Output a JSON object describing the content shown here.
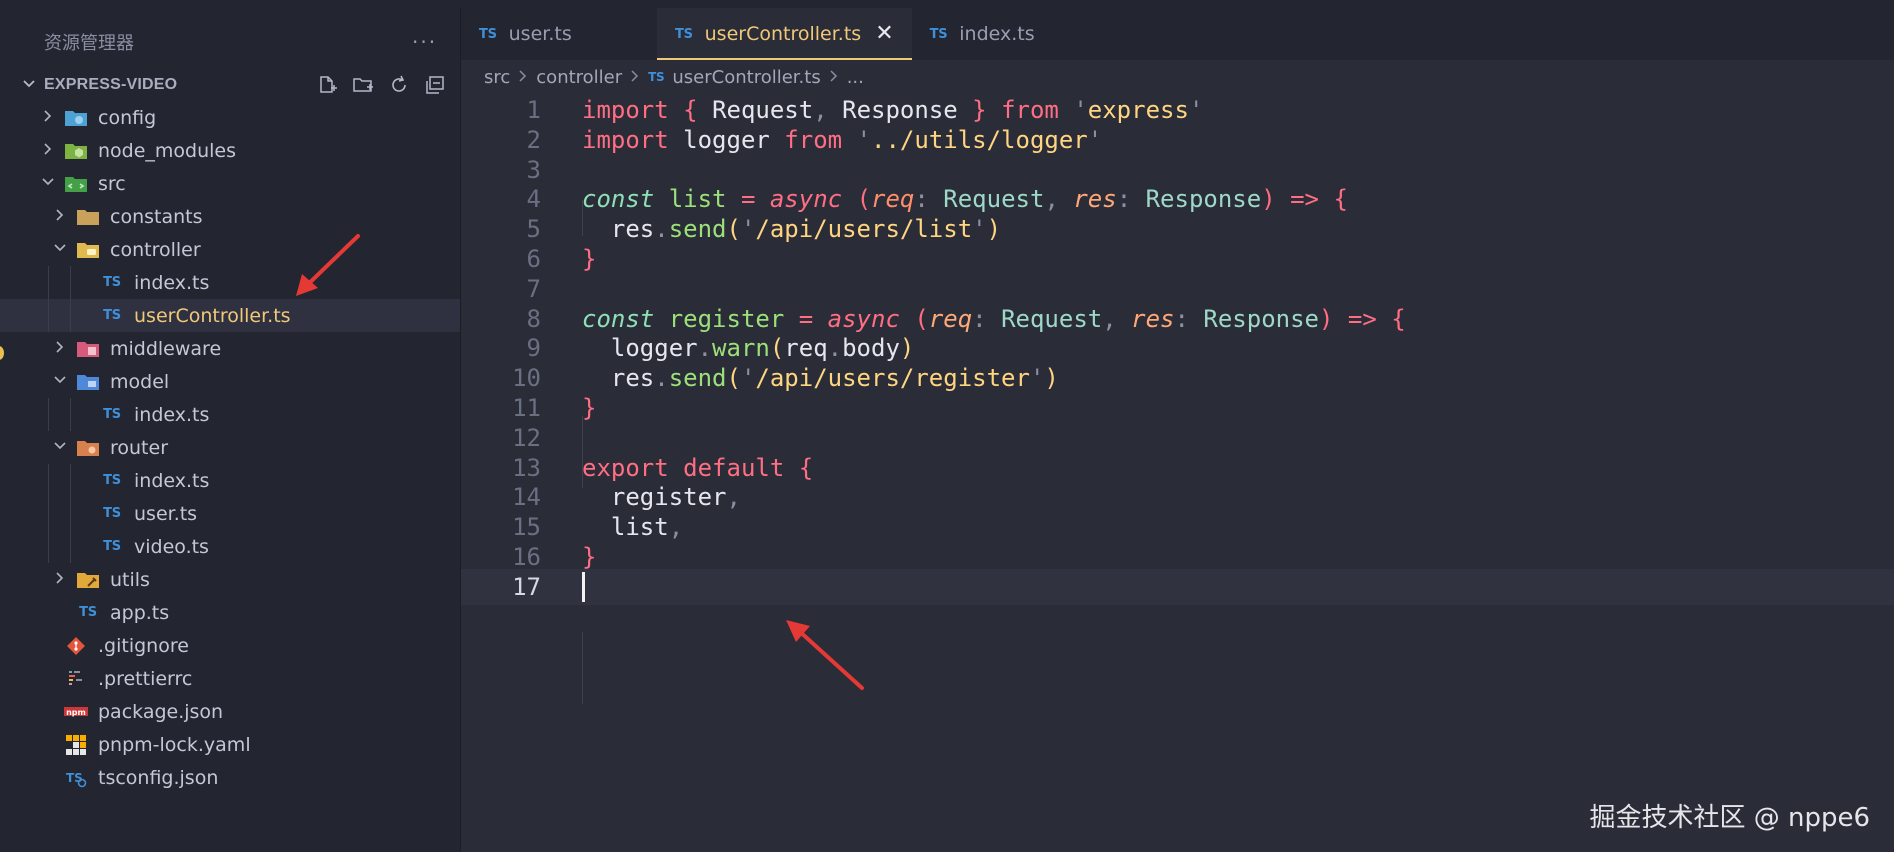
{
  "sidebar": {
    "title": "资源管理器",
    "more": "···",
    "root": "EXPRESS-VIDEO",
    "tree": [
      {
        "label": "config",
        "depth": 0,
        "kind": "folder",
        "open": false,
        "icon": "config-folder-icon"
      },
      {
        "label": "node_modules",
        "depth": 0,
        "kind": "folder",
        "open": false,
        "icon": "node-modules-folder-icon"
      },
      {
        "label": "src",
        "depth": 0,
        "kind": "folder",
        "open": true,
        "icon": "src-folder-icon"
      },
      {
        "label": "constants",
        "depth": 1,
        "kind": "folder",
        "open": false,
        "icon": "folder-icon"
      },
      {
        "label": "controller",
        "depth": 1,
        "kind": "folder",
        "open": true,
        "icon": "controller-folder-icon"
      },
      {
        "label": "index.ts",
        "depth": 2,
        "kind": "ts"
      },
      {
        "label": "userController.ts",
        "depth": 2,
        "kind": "ts",
        "selected": true
      },
      {
        "label": "middleware",
        "depth": 1,
        "kind": "folder",
        "open": false,
        "icon": "middleware-folder-icon"
      },
      {
        "label": "model",
        "depth": 1,
        "kind": "folder",
        "open": true,
        "icon": "model-folder-icon"
      },
      {
        "label": "index.ts",
        "depth": 2,
        "kind": "ts"
      },
      {
        "label": "router",
        "depth": 1,
        "kind": "folder",
        "open": true,
        "icon": "router-folder-icon"
      },
      {
        "label": "index.ts",
        "depth": 2,
        "kind": "ts"
      },
      {
        "label": "user.ts",
        "depth": 2,
        "kind": "ts"
      },
      {
        "label": "video.ts",
        "depth": 2,
        "kind": "ts"
      },
      {
        "label": "utils",
        "depth": 1,
        "kind": "folder",
        "open": false,
        "icon": "utils-folder-icon"
      },
      {
        "label": "app.ts",
        "depth": 1,
        "kind": "ts"
      },
      {
        "label": ".gitignore",
        "depth": 0,
        "kind": "file",
        "icon": "git-icon"
      },
      {
        "label": ".prettierrc",
        "depth": 0,
        "kind": "file",
        "icon": "prettier-icon"
      },
      {
        "label": "package.json",
        "depth": 0,
        "kind": "file",
        "icon": "npm-icon"
      },
      {
        "label": "pnpm-lock.yaml",
        "depth": 0,
        "kind": "file",
        "icon": "pnpm-icon"
      },
      {
        "label": "tsconfig.json",
        "depth": 0,
        "kind": "file",
        "icon": "tsconfig-icon"
      }
    ]
  },
  "tabs": [
    {
      "label": "user.ts",
      "active": false
    },
    {
      "label": "userController.ts",
      "active": true
    },
    {
      "label": "index.ts",
      "active": false
    }
  ],
  "ts_badge": "TS",
  "close_glyph": "✕",
  "breadcrumb": [
    "src",
    "controller",
    "userController.ts",
    "..."
  ],
  "code_lines": [
    [
      [
        "kw",
        "import "
      ],
      [
        "brk",
        "{ "
      ],
      [
        "",
        "Request"
      ],
      [
        "punc",
        ", "
      ],
      [
        "",
        "Response"
      ],
      [
        "brk",
        " }"
      ],
      [
        "kw",
        " from "
      ],
      [
        "punc",
        "'"
      ],
      [
        "str",
        "express"
      ],
      [
        "punc",
        "'"
      ]
    ],
    [
      [
        "kw",
        "import "
      ],
      [
        "",
        "logger"
      ],
      [
        "kw",
        " from "
      ],
      [
        "punc",
        "'"
      ],
      [
        "str",
        "../utils/logger"
      ],
      [
        "punc",
        "'"
      ]
    ],
    [],
    [
      [
        "it",
        "const "
      ],
      [
        "fn",
        "list"
      ],
      [
        "kw",
        " = "
      ],
      [
        "as",
        "async "
      ],
      [
        "brk",
        "("
      ],
      [
        "prm",
        "req"
      ],
      [
        "punc",
        ": "
      ],
      [
        "typ",
        "Request"
      ],
      [
        "punc",
        ", "
      ],
      [
        "prm2",
        "res"
      ],
      [
        "punc",
        ": "
      ],
      [
        "typ",
        "Response"
      ],
      [
        "brk",
        ")"
      ],
      [
        "kw",
        " => "
      ],
      [
        "brk",
        "{"
      ]
    ],
    [
      [
        "",
        "  res"
      ],
      [
        "punc",
        "."
      ],
      [
        "fn",
        "send"
      ],
      [
        "brk2",
        "("
      ],
      [
        "punc",
        "'"
      ],
      [
        "str",
        "/api/users/list"
      ],
      [
        "punc",
        "'"
      ],
      [
        "brk2",
        ")"
      ]
    ],
    [
      [
        "brk",
        "}"
      ]
    ],
    [],
    [
      [
        "it",
        "const "
      ],
      [
        "fn",
        "register"
      ],
      [
        "kw",
        " = "
      ],
      [
        "as",
        "async "
      ],
      [
        "brk",
        "("
      ],
      [
        "prm2",
        "req"
      ],
      [
        "punc",
        ": "
      ],
      [
        "typ",
        "Request"
      ],
      [
        "punc",
        ", "
      ],
      [
        "prm2",
        "res"
      ],
      [
        "punc",
        ": "
      ],
      [
        "typ",
        "Response"
      ],
      [
        "brk",
        ")"
      ],
      [
        "kw",
        " => "
      ],
      [
        "brk",
        "{"
      ]
    ],
    [
      [
        "",
        "  logger"
      ],
      [
        "punc",
        "."
      ],
      [
        "fn",
        "warn"
      ],
      [
        "brk2",
        "("
      ],
      [
        "",
        "req"
      ],
      [
        "punc",
        "."
      ],
      [
        "",
        "body"
      ],
      [
        "brk2",
        ")"
      ]
    ],
    [
      [
        "",
        "  res"
      ],
      [
        "punc",
        "."
      ],
      [
        "fn",
        "send"
      ],
      [
        "brk2",
        "("
      ],
      [
        "punc",
        "'"
      ],
      [
        "str",
        "/api/users/register"
      ],
      [
        "punc",
        "'"
      ],
      [
        "brk2",
        ")"
      ]
    ],
    [
      [
        "brk",
        "}"
      ]
    ],
    [],
    [
      [
        "kw",
        "export default "
      ],
      [
        "brk",
        "{"
      ]
    ],
    [
      [
        "",
        "  register"
      ],
      [
        "punc",
        ","
      ]
    ],
    [
      [
        "",
        "  list"
      ],
      [
        "punc",
        ","
      ]
    ],
    [
      [
        "brk",
        "}"
      ]
    ],
    []
  ],
  "current_line": 17,
  "watermark": "掘金技术社区 @ nppe6",
  "colors": {
    "accent": "#f0c978",
    "ts": "#3f8fd9",
    "annotation_arrow": "#e53935"
  }
}
